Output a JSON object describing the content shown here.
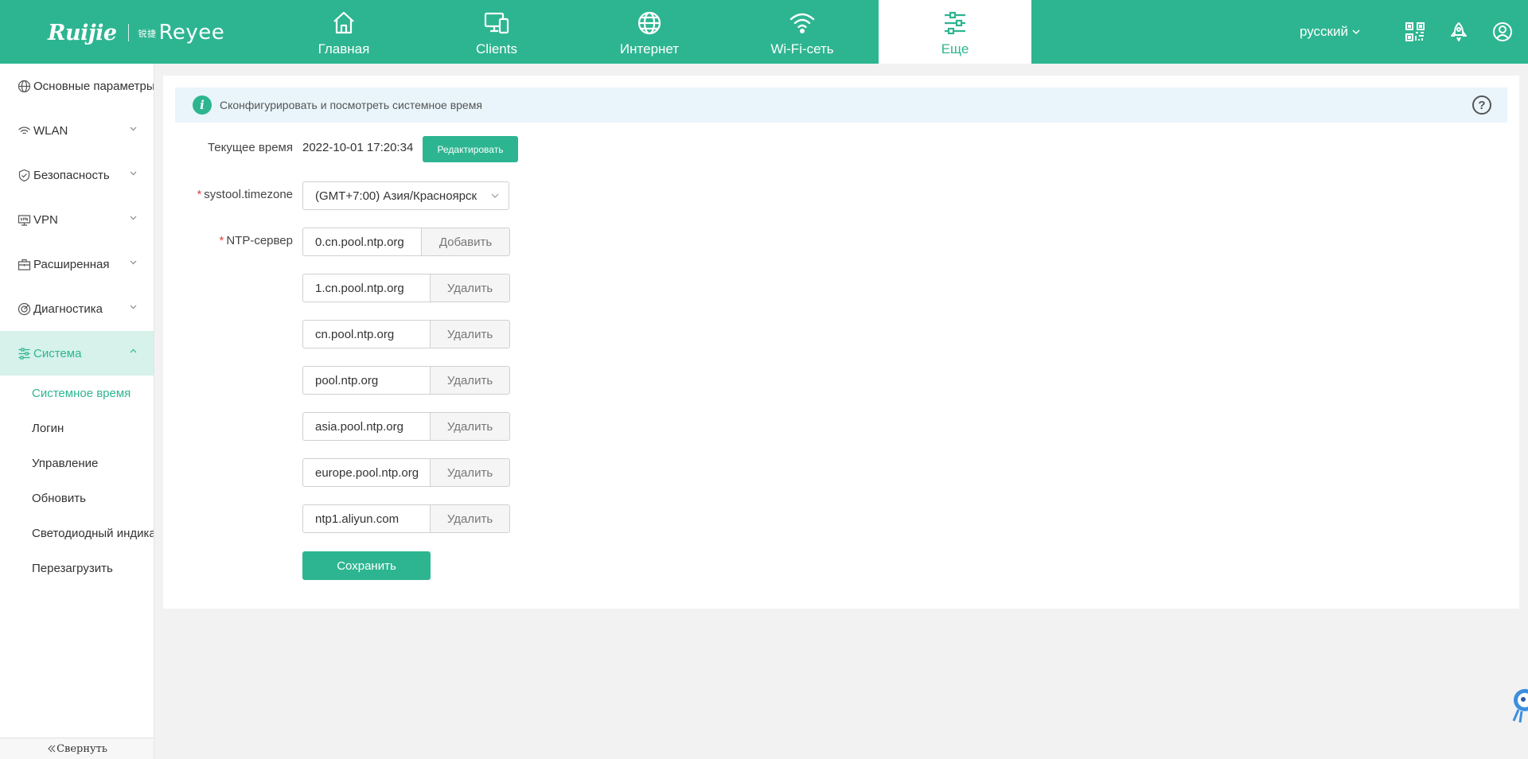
{
  "brand": {
    "logo_left": "Ruijie",
    "logo_right_small": "锐捷",
    "logo_right": "Reyee"
  },
  "nav": [
    {
      "label": "Главная",
      "icon": "home-icon"
    },
    {
      "label": "Clients",
      "icon": "devices-icon"
    },
    {
      "label": "Интернет",
      "icon": "globe-icon"
    },
    {
      "label": "Wi-Fi-сеть",
      "icon": "wifi-icon"
    },
    {
      "label": "Еще",
      "icon": "sliders-icon",
      "active": true
    }
  ],
  "header_right": {
    "language": "русский",
    "icons": [
      "qr-code-icon",
      "rocket-icon",
      "user-icon"
    ]
  },
  "sidebar": {
    "groups": [
      {
        "label": "Основные параметры",
        "icon": "globe-icon"
      },
      {
        "label": "WLAN",
        "icon": "wifi-icon"
      },
      {
        "label": "Безопасность",
        "icon": "shield-icon"
      },
      {
        "label": "VPN",
        "icon": "vpn-icon"
      },
      {
        "label": "Расширенная",
        "icon": "toolbox-icon"
      },
      {
        "label": "Диагностика",
        "icon": "diagnostics-icon"
      },
      {
        "label": "Система",
        "icon": "sliders-icon",
        "active": true
      }
    ],
    "sub_items": [
      {
        "label": "Системное время",
        "active": true
      },
      {
        "label": "Логин"
      },
      {
        "label": "Управление"
      },
      {
        "label": "Обновить"
      },
      {
        "label": "Светодиодный индикатор"
      },
      {
        "label": "Перезагрузить"
      }
    ],
    "collapse_label": "Свернуть"
  },
  "info": {
    "text": "Сконфигурировать и посмотреть системное время",
    "icon": "info-icon",
    "help_icon": "help-icon"
  },
  "form": {
    "current_time_label": "Текущее время",
    "current_time_value": "2022-10-01 17:20:34",
    "edit_button": "Редактировать",
    "timezone_label": "systool.timezone",
    "timezone_value": "(GMT+7:00) Азия/Красноярск",
    "ntp_label": "NTP-сервер",
    "ntp_servers": [
      {
        "value": "0.cn.pool.ntp.org",
        "action": "Добавить"
      },
      {
        "value": "1.cn.pool.ntp.org",
        "action": "Удалить"
      },
      {
        "value": "cn.pool.ntp.org",
        "action": "Удалить"
      },
      {
        "value": "pool.ntp.org",
        "action": "Удалить"
      },
      {
        "value": "asia.pool.ntp.org",
        "action": "Удалить"
      },
      {
        "value": "europe.pool.ntp.org",
        "action": "Удалить"
      },
      {
        "value": "ntp1.aliyun.com",
        "action": "Удалить"
      }
    ],
    "save_button": "Сохранить"
  },
  "colors": {
    "accent": "#2db591",
    "accent_light": "#d6f2ea",
    "info_bg": "#e9f5fb",
    "required": "#e0443f"
  }
}
